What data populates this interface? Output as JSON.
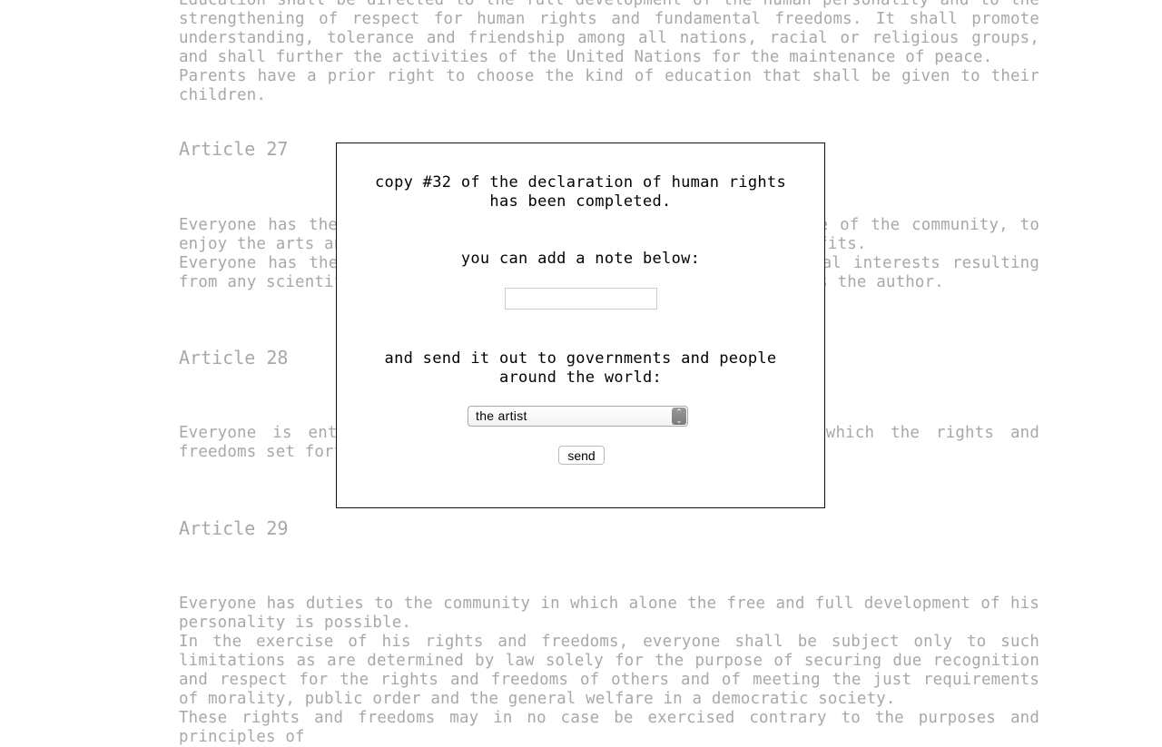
{
  "document": {
    "article26_tail": [
      "Education shall be directed to the full development of the human personality and to the strengthening of respect for human rights and fundamental freedoms. It shall promote understanding, tolerance and friendship among all nations, racial or religious groups, and shall further the activities of the United Nations for the maintenance of peace.",
      "Parents have a prior right to choose the kind of education that shall be given to their children."
    ],
    "articles": [
      {
        "title": "Article 27",
        "paragraphs": [
          "Everyone has the right freely to participate in the cultural life of the community, to enjoy the arts and to share in scientific advancement and its benefits.",
          "Everyone has the right to the protection of the moral and material interests resulting from any scientific, literary or artistic production of which he is the author."
        ]
      },
      {
        "title": "Article 28",
        "paragraphs": [
          "Everyone is entitled to a social and international order in which the rights and freedoms set forth in this Declaration can be fully realized."
        ]
      },
      {
        "title": "Article 29",
        "paragraphs": [
          "Everyone has duties to the community in which alone the free and full development of his personality is possible.",
          "In the exercise of his rights and freedoms, everyone shall be subject only to such limitations as are determined by law solely for the purpose of securing due recognition and respect for the rights and freedoms of others and of meeting the just requirements of morality, public order and the general welfare in a democratic society.",
          "These rights and freedoms may in no case be exercised contrary to the purposes and principles of"
        ]
      }
    ]
  },
  "modal": {
    "completed_message": "copy #32 of the declaration of human rights has been completed.",
    "note_prompt": "you can add a note below:",
    "note_value": "",
    "send_prompt": "and send it out to governments and people around the world:",
    "recipient_selected": "the artist",
    "send_label": "send"
  }
}
